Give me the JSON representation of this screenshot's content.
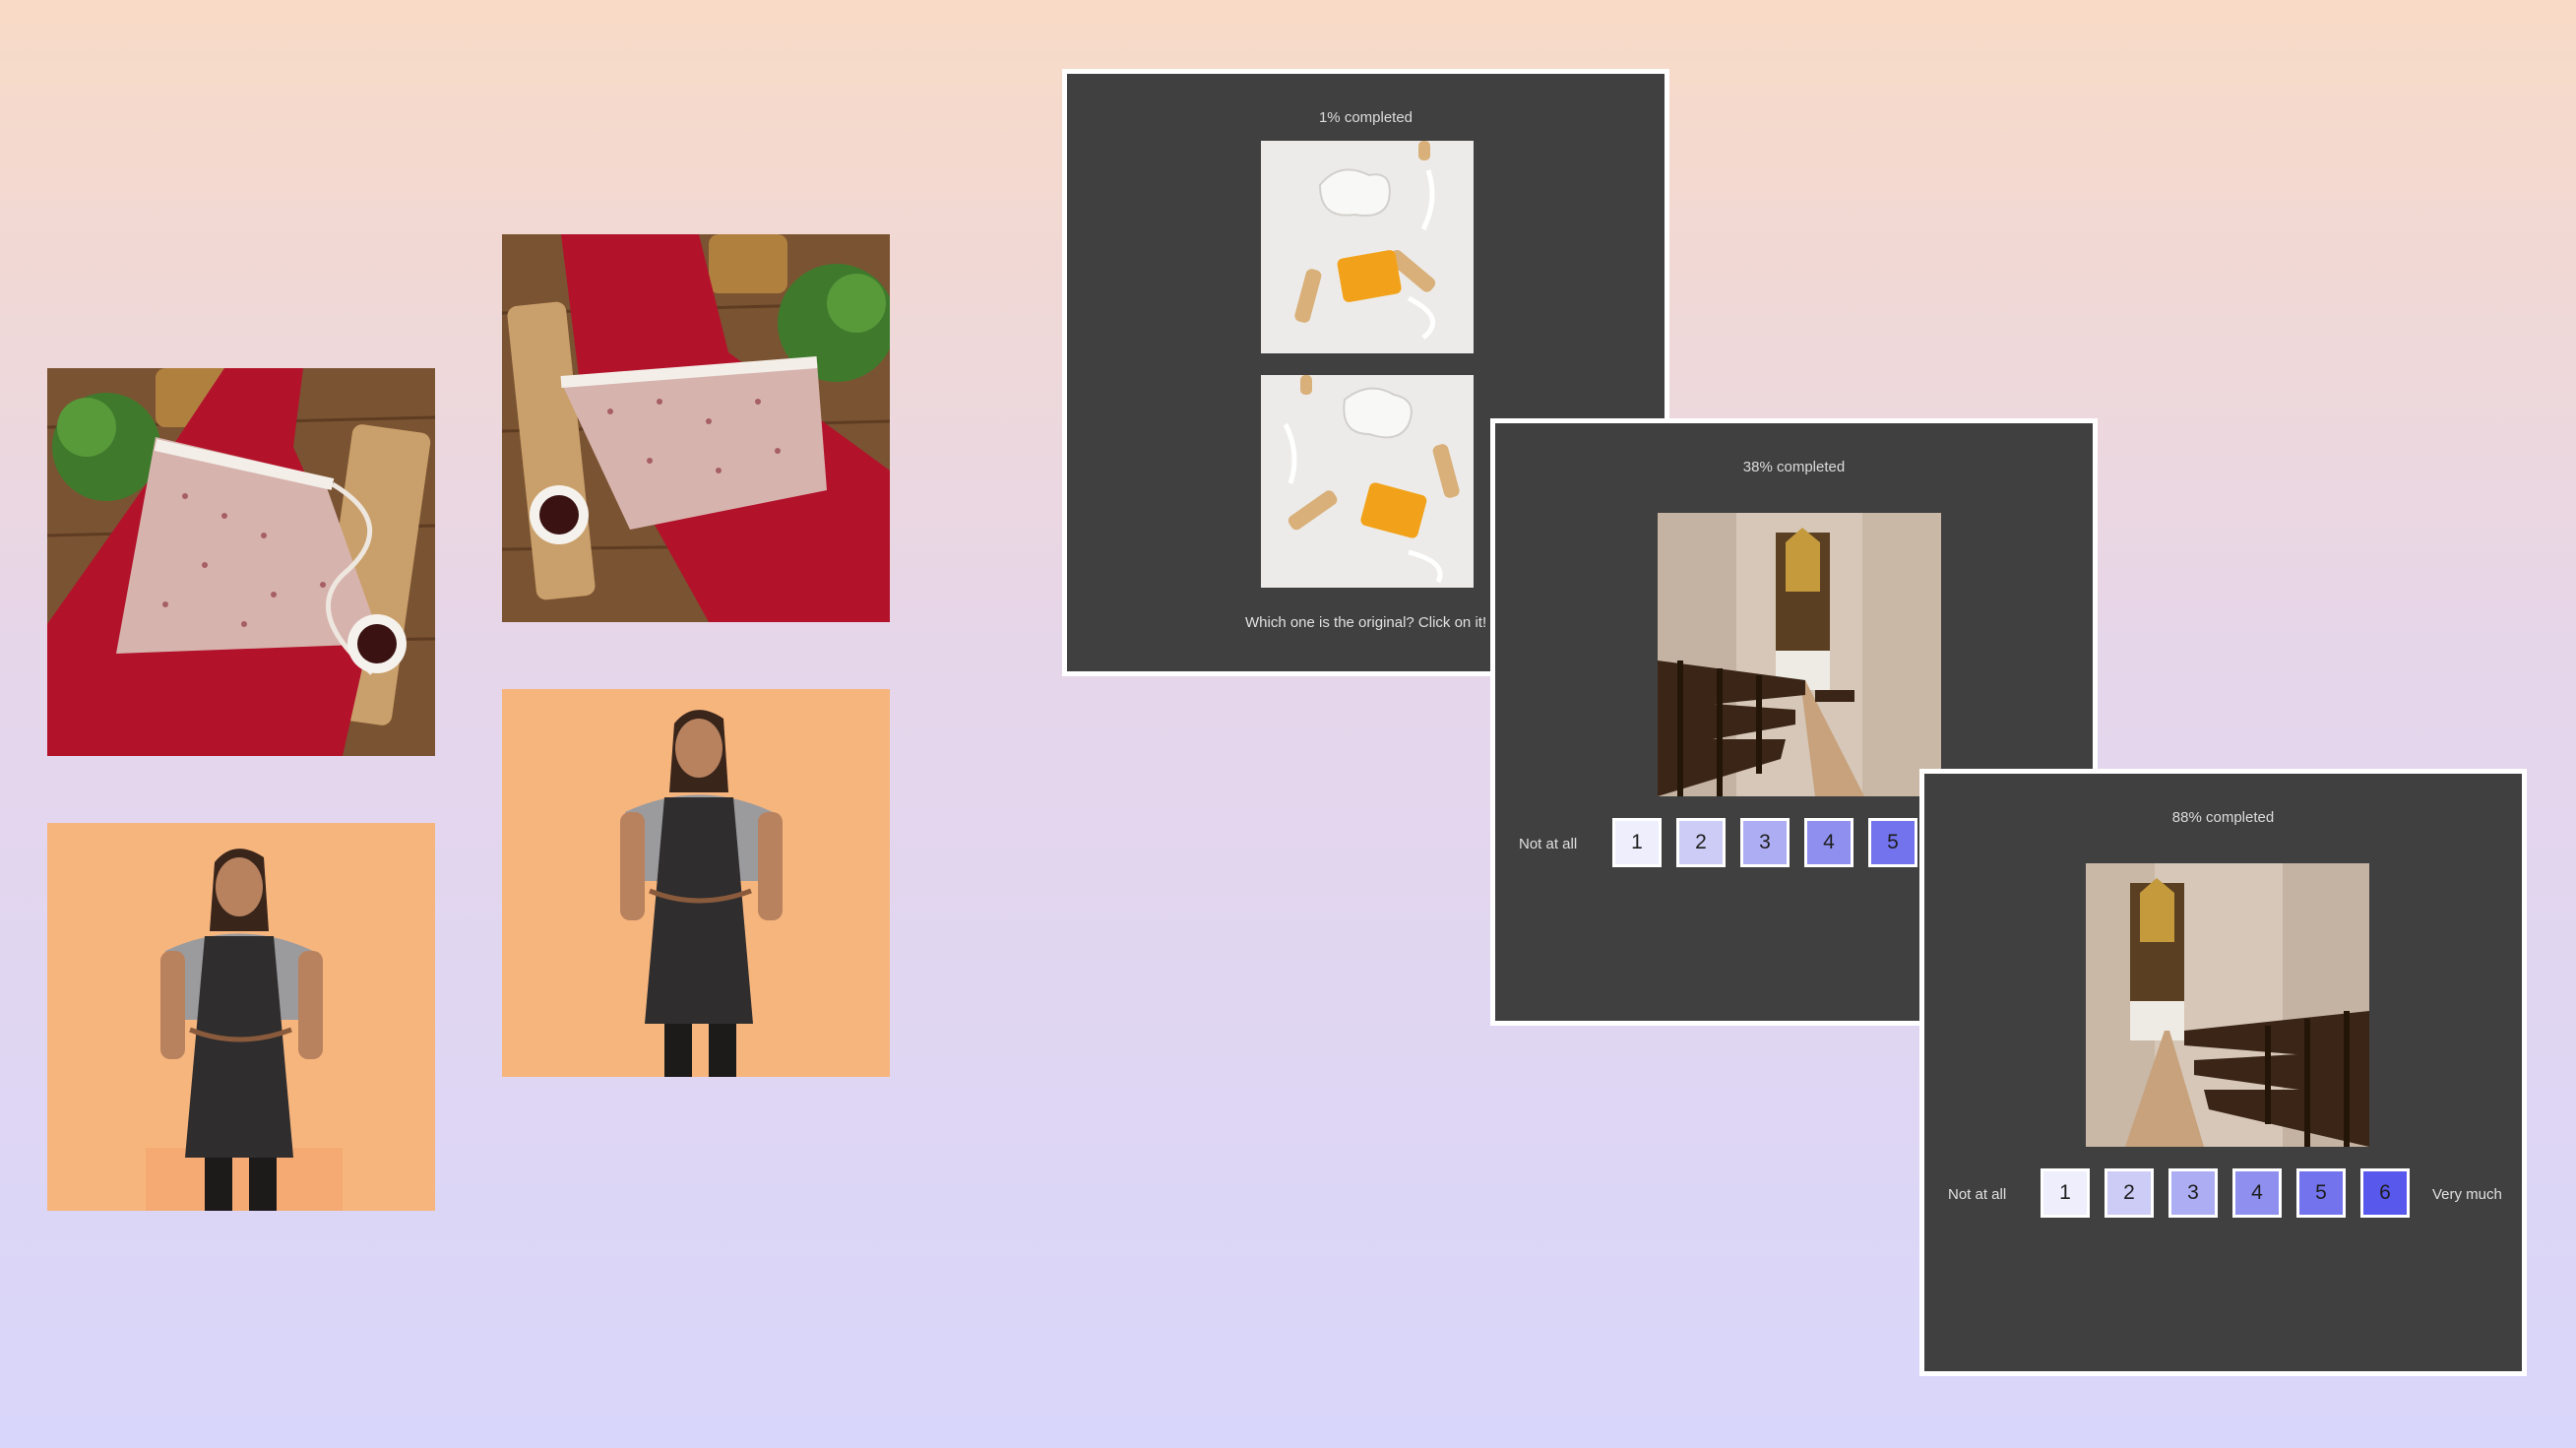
{
  "stimulus_set": {
    "aprons_flatlay": [
      "apron-flatlay-photo-a",
      "apron-flatlay-photo-b"
    ],
    "aprons_person": [
      "apron-person-photo-a",
      "apron-person-photo-b"
    ]
  },
  "screens": [
    {
      "progress": "1% completed",
      "question": "Which one is the original? Click on it!"
    },
    {
      "progress": "38% completed",
      "scale_low": "Not at all",
      "ratings": [
        "1",
        "2",
        "3",
        "4",
        "5"
      ]
    },
    {
      "progress": "88% completed",
      "scale_low": "Not at all",
      "scale_high": "Very much",
      "ratings": [
        "1",
        "2",
        "3",
        "4",
        "5",
        "6"
      ]
    }
  ],
  "rating_colors": [
    "#eeeefc",
    "#ccccf7",
    "#adadf3",
    "#8f8ff0",
    "#7373ee",
    "#5858ec"
  ]
}
